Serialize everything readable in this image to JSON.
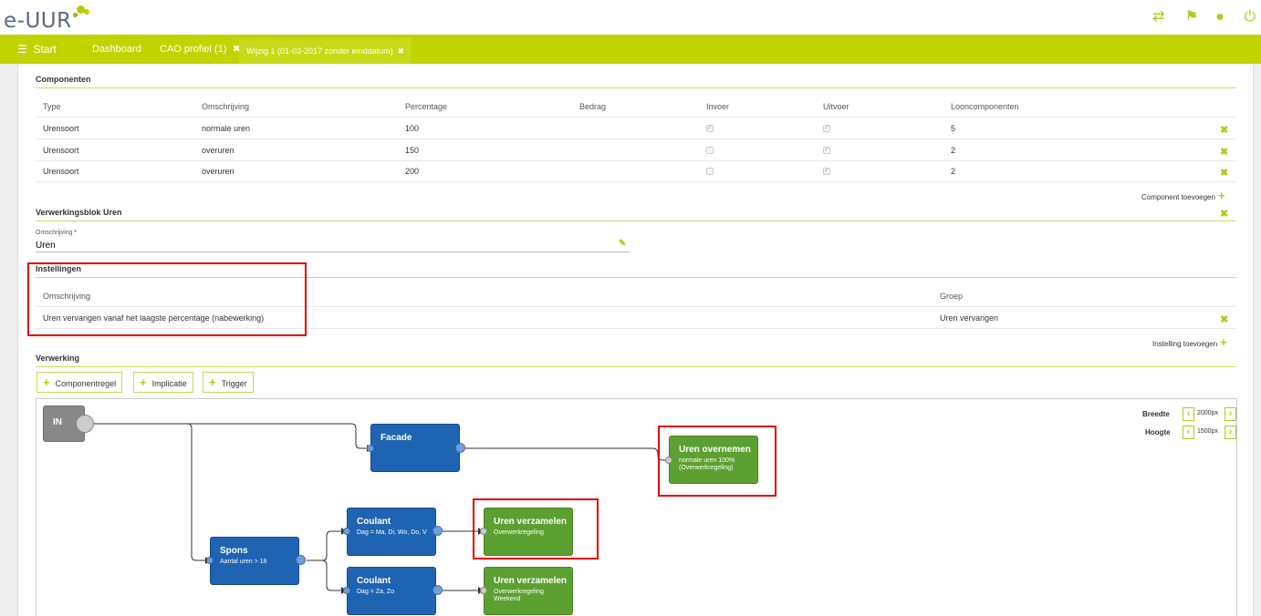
{
  "app": {
    "logo_text": "e-UUR"
  },
  "nav": {
    "start": "Start",
    "tabs": [
      {
        "label": "Dashboard"
      },
      {
        "label": "CAO profiel (1)"
      },
      {
        "label": "Wijzig 1 (01-03-2017 zonder einddatum)"
      }
    ]
  },
  "componenten": {
    "title": "Componenten",
    "headers": [
      "Type",
      "Omschrijving",
      "Percentage",
      "Bedrag",
      "Invoer",
      "Uitvoer",
      "Looncomponenten"
    ],
    "rows": [
      {
        "type": "Urensoort",
        "omschrijving": "normale uren",
        "percentage": "100",
        "bedrag": "",
        "invoer": true,
        "uitvoer": true,
        "looncomponenten": "5"
      },
      {
        "type": "Urensoort",
        "omschrijving": "overuren",
        "percentage": "150",
        "bedrag": "",
        "invoer": false,
        "uitvoer": true,
        "looncomponenten": "2"
      },
      {
        "type": "Urensoort",
        "omschrijving": "overuren",
        "percentage": "200",
        "bedrag": "",
        "invoer": false,
        "uitvoer": true,
        "looncomponenten": "2"
      }
    ],
    "add_label": "Component toevoegen"
  },
  "verwerkingsblok": {
    "title": "Verwerkingsblok Uren",
    "field_label": "Omschrijving",
    "required_mark": "*",
    "field_value": "Uren"
  },
  "instellingen": {
    "title": "Instellingen",
    "headers": [
      "Omschrijving",
      "Groep"
    ],
    "rows": [
      {
        "omschrijving": "Uren vervangen vanaf het laagste percentage (nabewerking)",
        "groep": "Uren vervangen"
      }
    ],
    "add_label": "Instelling toevoegen"
  },
  "verwerking": {
    "title": "Verwerking",
    "buttons": [
      "Componentregel",
      "Implicatie",
      "Trigger"
    ],
    "breedte_label": "Breedte",
    "breedte_value": "2000px",
    "hoogte_label": "Hoogte",
    "hoogte_value": "1500px",
    "nodes": {
      "in": {
        "title": "IN"
      },
      "facade": {
        "title": "Facade"
      },
      "uren_overnemen": {
        "title": "Uren overnemen",
        "sub1": "normale uren 100%",
        "sub2": "(Overwerkregeling)"
      },
      "coulant1": {
        "title": "Coulant",
        "sub1": "Dag = Ma, Di, Wo, Do, V"
      },
      "uren_verzamelen1": {
        "title": "Uren verzamelen",
        "sub1": "Overwerkregeling"
      },
      "spons": {
        "title": "Spons",
        "sub1": "Aantal uren > 16"
      },
      "coulant2": {
        "title": "Coulant",
        "sub1": "Dag = Za, Zo"
      },
      "uren_verzamelen2": {
        "title": "Uren verzamelen",
        "sub1": "Overwerkregeling",
        "sub2": "Weekend"
      }
    }
  },
  "colors": {
    "accent": "#c1d400",
    "node_blue": "#1f63b3",
    "node_green": "#5ba030",
    "highlight": "#e00000"
  }
}
